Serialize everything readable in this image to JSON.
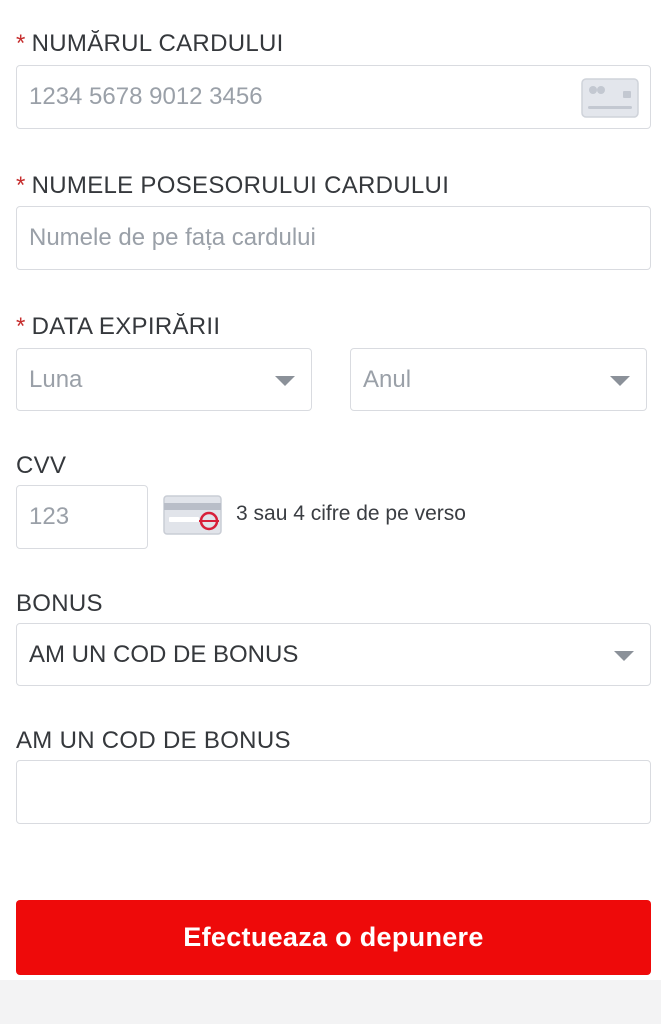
{
  "card_number": {
    "required_mark": "*",
    "label": "NUMĂRUL CARDULUI",
    "placeholder": "1234 5678 9012 3456",
    "icon": "credit-card-icon"
  },
  "card_holder": {
    "required_mark": "*",
    "label": "NUMELE POSESORULUI CARDULUI",
    "placeholder": "Numele de pe fața cardului"
  },
  "expiry": {
    "required_mark": "*",
    "label": "DATA EXPIRĂRII",
    "month_placeholder": "Luna",
    "year_placeholder": "Anul"
  },
  "cvv": {
    "label": "CVV",
    "placeholder": "123",
    "icon": "card-back-cvv-icon",
    "hint": "3 sau 4 cifre de pe verso"
  },
  "bonus": {
    "label": "BONUS",
    "selected": "AM UN COD DE BONUS"
  },
  "bonus_code": {
    "label": "AM UN COD DE BONUS",
    "value": ""
  },
  "submit": {
    "label": "Efectueaza o depunere"
  },
  "colors": {
    "accent": "#ee0a0a",
    "required": "#c62d2d",
    "border": "#d9dbe0",
    "placeholder": "#9aa0a8"
  }
}
